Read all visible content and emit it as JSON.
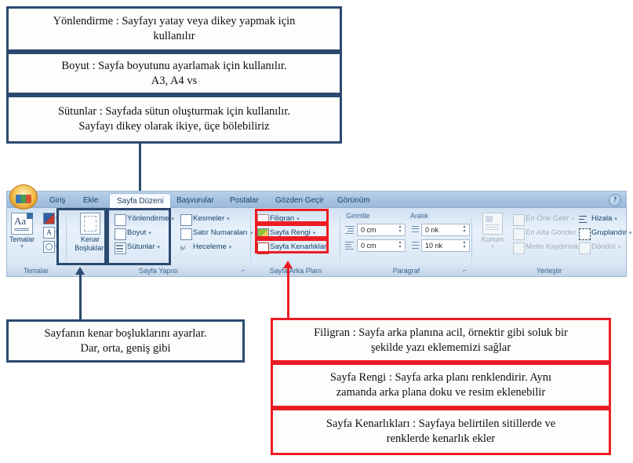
{
  "callouts": {
    "top": [
      {
        "id": "yonlendirme",
        "line1": "Yönlendirme : Sayfayı yatay veya dikey yapmak için",
        "line2": "kullanılır"
      },
      {
        "id": "boyut",
        "line1": "Boyut : Sayfa boyutunu ayarlamak için kullanılır.",
        "line2": "A3, A4 vs"
      },
      {
        "id": "sutunlar",
        "line1": "Sütunlar : Sayfada sütun oluşturmak için kullanılır.",
        "line2": "Sayfayı dikey olarak ikiye, üçe bölebiliriz"
      }
    ],
    "bottom_left": {
      "id": "kenar-bosluklari",
      "line1": "Sayfanın kenar boşluklarını ayarlar.",
      "line2": "Dar, orta, geniş gibi"
    },
    "bottom_right": [
      {
        "id": "filigran",
        "line1": "Filigran : Sayfa arka planına acil, örnektir gibi soluk bir",
        "line2": "şekilde yazı eklememizi sağlar"
      },
      {
        "id": "sayfa-rengi",
        "line1": "Sayfa Rengi : Sayfa arka planı renklendirir. Aynı",
        "line2": "zamanda arka plana doku ve resim eklenebilir"
      },
      {
        "id": "sayfa-kenarliklari",
        "line1": "Sayfa Kenarlıkları : Sayfaya belirtilen sitillerde ve",
        "line2": "renklerde kenarlık ekler"
      }
    ]
  },
  "ribbon": {
    "office_button": "office-orb",
    "help_button": "?",
    "tabs": [
      {
        "label": "Giriş",
        "active": false
      },
      {
        "label": "Ekle",
        "active": false
      },
      {
        "label": "Sayfa Düzeni",
        "active": true
      },
      {
        "label": "Başvurular",
        "active": false
      },
      {
        "label": "Postalar",
        "active": false
      },
      {
        "label": "Gözden Geçir",
        "active": false
      },
      {
        "label": "Görünüm",
        "active": false
      }
    ],
    "groups": {
      "temalar": {
        "label": "Temalar",
        "big_button": "Temalar",
        "items": [
          {
            "label": "",
            "icon": "theme-colors-icon"
          },
          {
            "label": "",
            "icon": "theme-fonts-icon"
          },
          {
            "label": "",
            "icon": "theme-effects-icon"
          }
        ]
      },
      "sayfa_yapisi": {
        "label": "Sayfa Yapısı",
        "big_button_line1": "Kenar",
        "big_button_line2": "Boşlukları",
        "col1": [
          {
            "label": "Yönlendirme",
            "icon": "orientation-icon",
            "caret": true
          },
          {
            "label": "Boyut",
            "icon": "size-icon",
            "caret": true
          },
          {
            "label": "Sütunlar",
            "icon": "columns-icon",
            "caret": true
          }
        ],
        "col2": [
          {
            "label": "Kesmeler",
            "icon": "breaks-icon",
            "caret": true
          },
          {
            "label": "Satır Numaraları",
            "icon": "line-numbers-icon",
            "caret": true
          },
          {
            "label": "Heceleme",
            "icon": "hyphenation-icon",
            "caret": true
          }
        ]
      },
      "sayfa_arka_plani": {
        "label": "Sayfa Arka Planı",
        "items": [
          {
            "label": "Filigran",
            "icon": "watermark-icon",
            "caret": true
          },
          {
            "label": "Sayfa Rengi",
            "icon": "page-color-icon",
            "caret": true
          },
          {
            "label": "Sayfa Kenarlıkları",
            "icon": "page-borders-icon",
            "caret": false
          }
        ]
      },
      "paragraf": {
        "label": "Paragraf",
        "indent_label": "Girintile",
        "spacing_label": "Aralık",
        "indent_left": "0 cm",
        "indent_right": "0 cm",
        "spacing_before": "0 nk",
        "spacing_after": "10 nk"
      },
      "yerlestir": {
        "label": "Yerleştir",
        "big_button": "Konum",
        "items": [
          {
            "label": "En Öne Getir",
            "icon": "bring-to-front-icon",
            "caret": true,
            "disabled": true
          },
          {
            "label": "En Alta Gönder",
            "icon": "send-to-back-icon",
            "caret": true,
            "disabled": true
          },
          {
            "label": "Metin Kaydırma",
            "icon": "text-wrap-icon",
            "caret": true,
            "disabled": true
          },
          {
            "label": "Hizala",
            "icon": "align-icon",
            "caret": true,
            "disabled": false
          },
          {
            "label": "Gruplandır",
            "icon": "group-icon",
            "caret": true,
            "disabled": false
          },
          {
            "label": "Döndür",
            "icon": "rotate-icon",
            "caret": true,
            "disabled": true
          }
        ]
      }
    }
  },
  "colors": {
    "blue_border": "#2b4a6f",
    "red_border": "#ed1c24",
    "ribbon_text": "#15426b"
  }
}
